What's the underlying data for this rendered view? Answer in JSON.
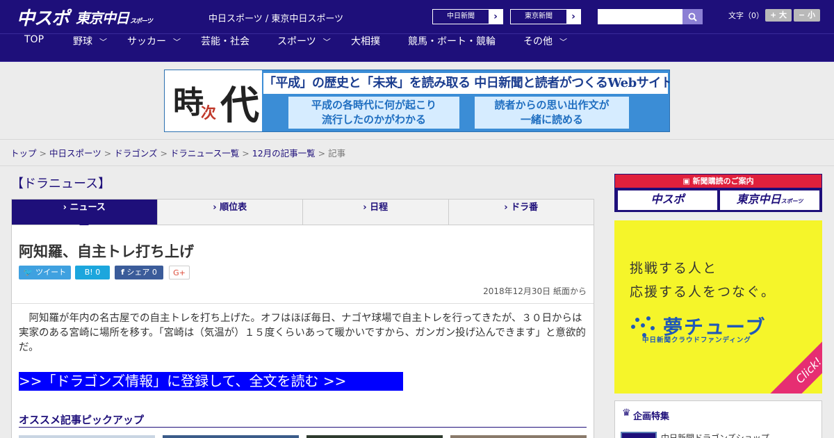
{
  "header": {
    "logo_main": "中スポ",
    "logo_sub": "東京中日",
    "logo_sub_small": "スポーツ",
    "site_links": "中日スポーツ / 東京中日スポーツ",
    "paper_buttons": [
      {
        "label": "中日新聞",
        "arrow": "›"
      },
      {
        "label": "東京新聞",
        "arrow": "›"
      }
    ],
    "search": {
      "placeholder": "",
      "value": ""
    },
    "font_size_label": "文字（0）",
    "font_bigger": "+ 大",
    "font_smaller": "− 小"
  },
  "nav": {
    "items": [
      {
        "label": "TOP",
        "has_dropdown": false
      },
      {
        "label": "野球",
        "has_dropdown": true
      },
      {
        "label": "サッカー",
        "has_dropdown": true
      },
      {
        "label": "芸能・社会",
        "has_dropdown": false
      },
      {
        "label": "スポーツ",
        "has_dropdown": true
      },
      {
        "label": "大相撲",
        "has_dropdown": false
      },
      {
        "label": "競馬・ボート・競輪",
        "has_dropdown": false
      },
      {
        "label": "その他",
        "has_dropdown": true
      }
    ]
  },
  "banner": {
    "logo_ji": "時",
    "logo_tsugi": "次",
    "logo_dai": "代",
    "headline": "「平成」の歴史と「未来」を読み取る 中日新聞と読者がつくるWebサイト",
    "box1_line1": "平成の各時代に何が起こり",
    "box1_line2": "流行したのかがわかる",
    "box2_line1": "読者からの思い出作文が",
    "box2_line2": "一緒に読める"
  },
  "breadcrumb": {
    "items": [
      "トップ",
      "中日スポーツ",
      "ドラゴンズ",
      "ドラニュース一覧",
      "12月の記事一覧"
    ],
    "current": "記事",
    "separator": ">"
  },
  "main": {
    "section_title": "【ドラニュース】",
    "tabs": [
      {
        "label": "› ニュース",
        "active": true
      },
      {
        "label": "› 順位表",
        "active": false
      },
      {
        "label": "› 日程",
        "active": false
      },
      {
        "label": "› ドラ番",
        "active": false
      }
    ],
    "article": {
      "title": "阿知羅、自主トレ打ち上げ",
      "share": {
        "tweet": "ツイート",
        "hatena": "B! 0",
        "facebook": "シェア 0",
        "gplus": "G+"
      },
      "date": "2018年12月30日 紙面から",
      "body": "阿知羅が年内の名古屋での自主トレを打ち上げた。オフはほぼ毎日、ナゴヤ球場で自主トレを行ってきたが、３０日からは実家のある宮崎に場所を移す。「宮崎は（気温が）１５度くらいあって暖かいですから、ガンガン投げ込んできます」と意欲的だ。",
      "cta": ">>「ドラゴンズ情報」に登録して、全文を読む >>",
      "pickup_title": "オススメ記事ピックアップ"
    }
  },
  "sidebar": {
    "subscribe_header": "新聞購読のご案内",
    "subscribe_buttons": [
      "中スポ",
      "東京中日"
    ],
    "subscribe_small": "スポーツ",
    "ad": {
      "line1": "挑戦する人と",
      "line2": "応援する人をつなぐ。",
      "logo": "夢チューブ",
      "sub": "中日新聞クラウドファンディング",
      "click": "Click!"
    },
    "kikaku_title": "企画特集",
    "kikaku_item": "中日新聞ドラゴンズショップ"
  },
  "colors": {
    "navy": "#1e0f7a",
    "cta_blue": "#0000ff",
    "ad_yellow": "#f5f52a",
    "red": "#e0203c"
  }
}
